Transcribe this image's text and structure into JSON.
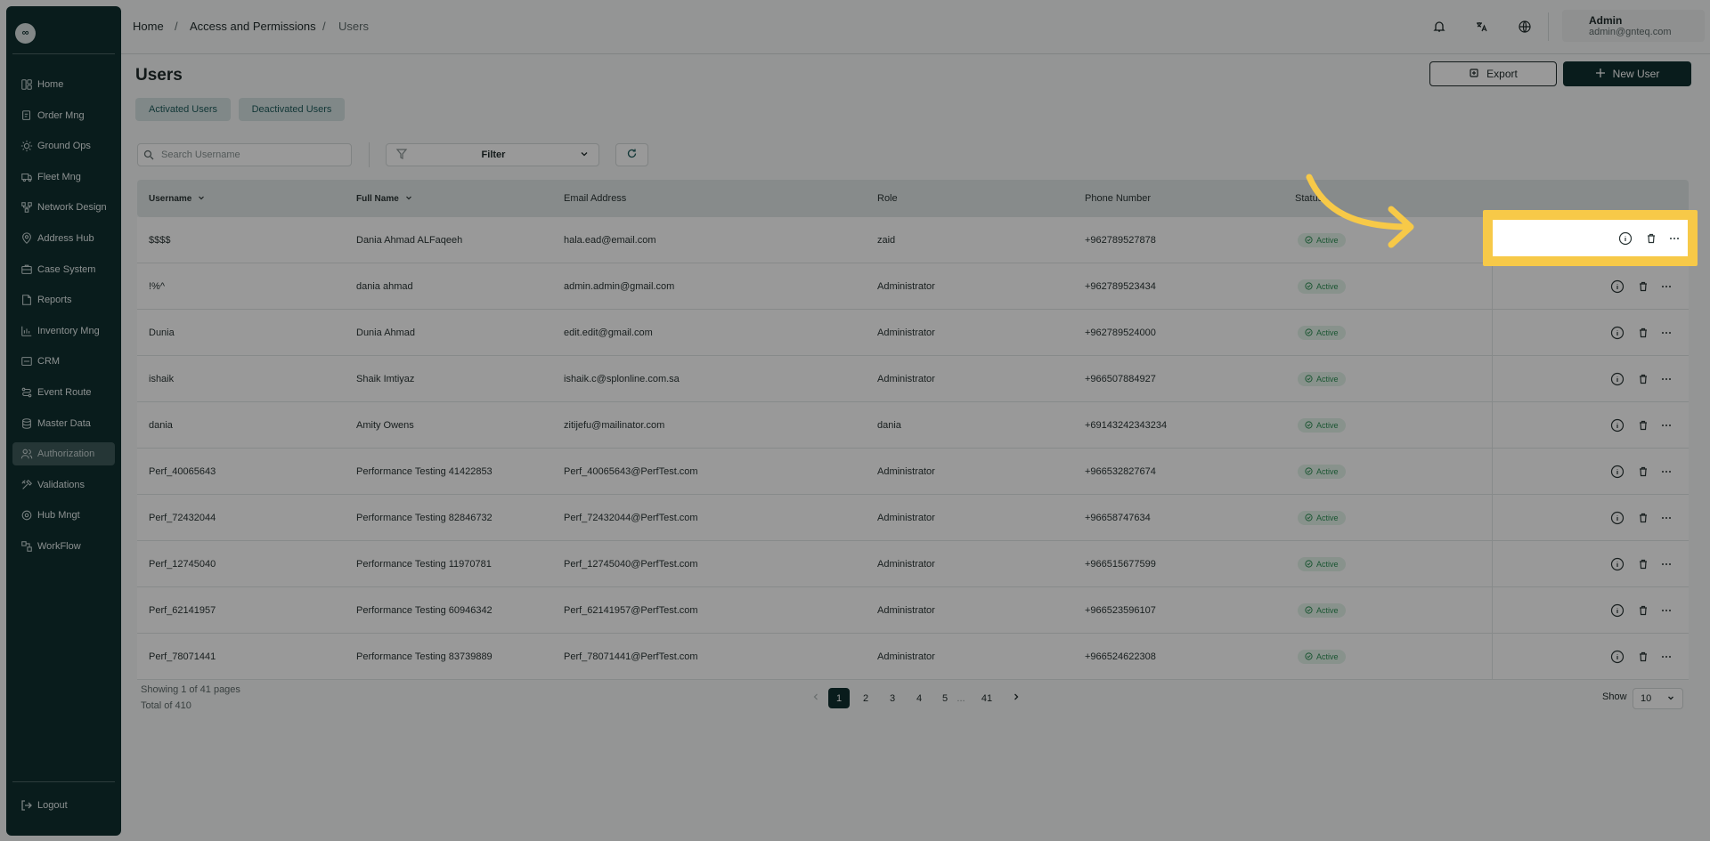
{
  "sidebar": {
    "logo_text": "∞",
    "items": [
      {
        "label": "Home",
        "icon": "home-icon"
      },
      {
        "label": "Order Mng",
        "icon": "order-icon"
      },
      {
        "label": "Ground Ops",
        "icon": "ground-ops-icon"
      },
      {
        "label": "Fleet Mng",
        "icon": "truck-icon"
      },
      {
        "label": "Network Design",
        "icon": "network-icon"
      },
      {
        "label": "Address Hub",
        "icon": "location-icon"
      },
      {
        "label": "Case System",
        "icon": "case-icon"
      },
      {
        "label": "Reports",
        "icon": "report-icon"
      },
      {
        "label": "Inventory Mng",
        "icon": "inventory-icon"
      },
      {
        "label": "CRM",
        "icon": "crm-icon"
      },
      {
        "label": "Event Route",
        "icon": "route-icon"
      },
      {
        "label": "Master Data",
        "icon": "database-icon"
      },
      {
        "label": "Authorization",
        "icon": "users-icon"
      },
      {
        "label": "Validations",
        "icon": "tools-icon"
      },
      {
        "label": "Hub Mngt",
        "icon": "hub-icon"
      },
      {
        "label": "WorkFlow",
        "icon": "workflow-icon"
      }
    ],
    "active_item": "Authorization",
    "logout_label": "Logout"
  },
  "breadcrumb": [
    "Home",
    "Access and Permissions",
    "Users"
  ],
  "user": {
    "name": "Admin",
    "email": "admin@gnteq.com"
  },
  "page": {
    "title": "Users",
    "export_label": "Export",
    "new_user_label": "New User"
  },
  "tabs": [
    "Activated Users",
    "Deactivated Users"
  ],
  "search": {
    "placeholder": "Search Username"
  },
  "filter": {
    "label": "Filter"
  },
  "table": {
    "columns": [
      "Username",
      "Full Name",
      "Email Address",
      "Role",
      "Phone Number",
      "Status"
    ],
    "rows": [
      {
        "username": "$$$$",
        "full_name": "Dania Ahmad ALFaqeeh",
        "email": "hala.ead@email.com",
        "role": "zaid",
        "phone": "+962789527878",
        "status": "Active"
      },
      {
        "username": "!%^",
        "full_name": "dania ahmad",
        "email": "admin.admin@gmail.com",
        "role": "Administrator",
        "phone": "+962789523434",
        "status": "Active"
      },
      {
        "username": "Dunia",
        "full_name": "Dunia Ahmad",
        "email": "edit.edit@gmail.com",
        "role": "Administrator",
        "phone": "+962789524000",
        "status": "Active"
      },
      {
        "username": "ishaik",
        "full_name": "Shaik Imtiyaz",
        "email": "ishaik.c@splonline.com.sa",
        "role": "Administrator",
        "phone": "+966507884927",
        "status": "Active"
      },
      {
        "username": "dania",
        "full_name": "Amity Owens",
        "email": "zitijefu@mailinator.com",
        "role": "dania",
        "phone": "+69143242343234",
        "status": "Active"
      },
      {
        "username": "Perf_40065643",
        "full_name": "Performance Testing 41422853",
        "email": "Perf_40065643@PerfTest.com",
        "role": "Administrator",
        "phone": "+966532827674",
        "status": "Active"
      },
      {
        "username": "Perf_72432044",
        "full_name": "Performance Testing 82846732",
        "email": "Perf_72432044@PerfTest.com",
        "role": "Administrator",
        "phone": "+96658747634",
        "status": "Active"
      },
      {
        "username": "Perf_12745040",
        "full_name": "Performance Testing 11970781",
        "email": "Perf_12745040@PerfTest.com",
        "role": "Administrator",
        "phone": "+966515677599",
        "status": "Active"
      },
      {
        "username": "Perf_62141957",
        "full_name": "Performance Testing 60946342",
        "email": "Perf_62141957@PerfTest.com",
        "role": "Administrator",
        "phone": "+966523596107",
        "status": "Active"
      },
      {
        "username": "Perf_78071441",
        "full_name": "Performance Testing 83739889",
        "email": "Perf_78071441@PerfTest.com",
        "role": "Administrator",
        "phone": "+966524622308",
        "status": "Active"
      }
    ]
  },
  "footer": {
    "showing": "Showing 1 of 41 pages",
    "total": "Total of 410",
    "pages": [
      "1",
      "2",
      "3",
      "4",
      "5",
      "...",
      "41"
    ],
    "current_page": "1",
    "show_label": "Show",
    "page_size": "10"
  },
  "colors": {
    "sidebar_bg": "#0f2f2f",
    "primary": "#0f2f2f",
    "highlight": "#f7c948",
    "active_badge": "#2f8f55"
  }
}
